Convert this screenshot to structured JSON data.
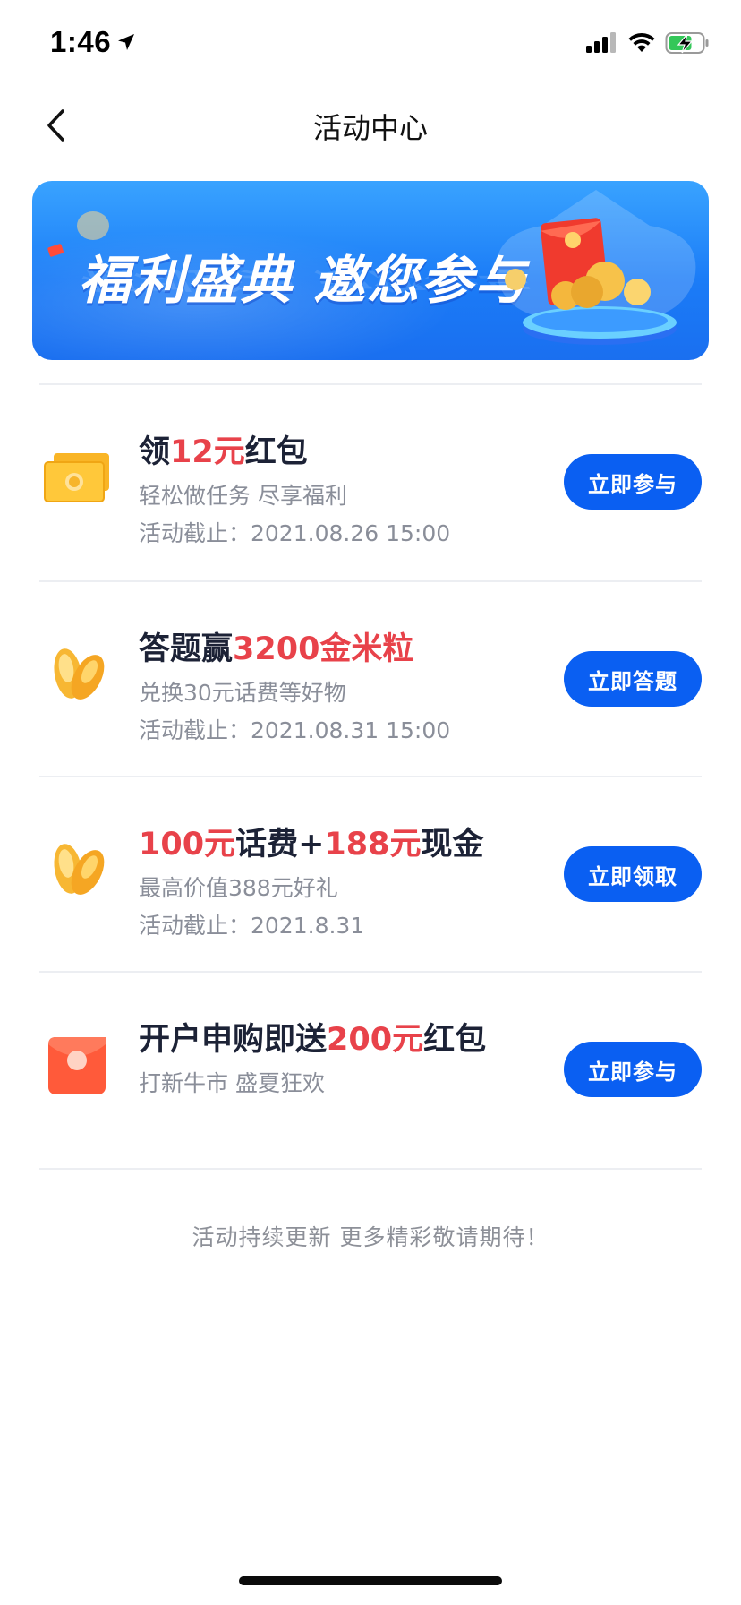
{
  "status_bar": {
    "time": "1:46"
  },
  "nav": {
    "title": "活动中心"
  },
  "banner": {
    "text": "福利盛典 邀您参与"
  },
  "activities": [
    {
      "title_parts": [
        "领",
        "12元",
        "红包"
      ],
      "subtitle": "轻松做任务 尽享福利",
      "deadline": "活动截止：2021.08.26 15:00",
      "button": "立即参与",
      "icon": "cash-stack-icon"
    },
    {
      "title_parts": [
        "答题赢",
        "3200金米粒",
        ""
      ],
      "subtitle": "兑换30元话费等好物",
      "deadline": "活动截止：2021.08.31 15:00",
      "button": "立即答题",
      "icon": "gold-rice-icon"
    },
    {
      "title_parts": [
        "",
        "100元",
        "话费+",
        "188元",
        "现金"
      ],
      "subtitle": "最高价值388元好礼",
      "deadline": "活动截止：2021.8.31",
      "button": "立即领取",
      "icon": "gold-rice-icon"
    },
    {
      "title_parts": [
        "开户申购即送",
        "200元",
        "红包"
      ],
      "subtitle": "打新牛市 盛夏狂欢",
      "deadline": "",
      "button": "立即参与",
      "icon": "red-envelope-icon"
    }
  ],
  "footer": {
    "note": "活动持续更新 更多精彩敬请期待！"
  },
  "colors": {
    "accent_blue": "#0a5ff2",
    "highlight_red": "#e8424a",
    "text_dark": "#1c2236",
    "text_gray": "#8a8e99"
  }
}
